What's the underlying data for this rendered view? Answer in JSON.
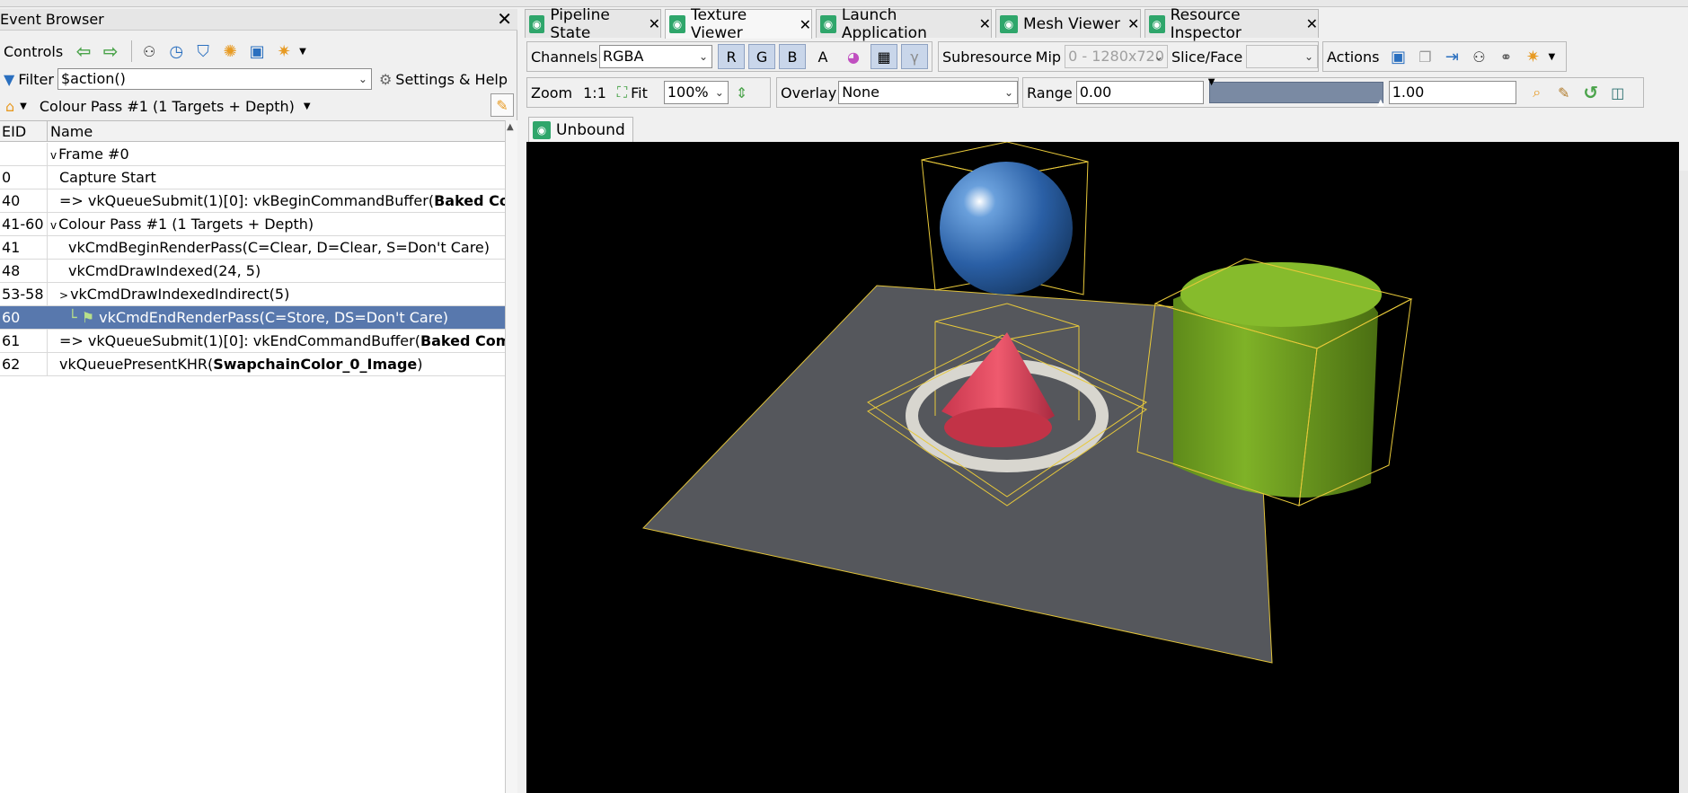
{
  "event_browser": {
    "title": "Event Browser",
    "controls_label": "Controls",
    "filter_label": "Filter",
    "filter_value": "$action()",
    "settings_label": "Settings & Help",
    "breadcrumb": "Colour Pass #1 (1 Targets + Depth)",
    "columns": {
      "eid": "EID",
      "name": "Name"
    },
    "rows": [
      {
        "eid": "",
        "name": "Frame #0",
        "expander": "v",
        "indent": 0
      },
      {
        "eid": "0",
        "name": "Capture Start",
        "expander": "",
        "indent": 1
      },
      {
        "eid": "40",
        "name": "=> vkQueueSubmit(1)[0]: vkBeginCommandBuffer(",
        "bold": "Baked Comm",
        "expander": "",
        "indent": 1
      },
      {
        "eid": "41-60",
        "name": "Colour Pass #1 (1 Targets + Depth)",
        "expander": "v",
        "indent": 0
      },
      {
        "eid": "41",
        "name": "vkCmdBeginRenderPass(C=Clear, D=Clear, S=Don't Care)",
        "expander": "",
        "indent": 2
      },
      {
        "eid": "48",
        "name": "vkCmdDrawIndexed(24, 5)",
        "expander": "",
        "indent": 2
      },
      {
        "eid": "53-58",
        "name": "vkCmdDrawIndexedIndirect(5)",
        "expander": ">",
        "indent": 1
      },
      {
        "eid": "60",
        "name": "vkCmdEndRenderPass(C=Store, DS=Don't Care)",
        "expander": "",
        "indent": 2,
        "selected": true
      },
      {
        "eid": "61",
        "name": "=> vkQueueSubmit(1)[0]: vkEndCommandBuffer(",
        "bold": "Baked Comman",
        "expander": "",
        "indent": 1
      },
      {
        "eid": "62",
        "name": "vkQueuePresentKHR(",
        "bold": "SwapchainColor_0_Image",
        "tail": ")",
        "expander": "",
        "indent": 1
      }
    ]
  },
  "tabs": [
    {
      "label": "Pipeline State"
    },
    {
      "label": "Texture Viewer"
    },
    {
      "label": "Launch Application"
    },
    {
      "label": "Mesh Viewer"
    },
    {
      "label": "Resource Inspector"
    }
  ],
  "texture_viewer": {
    "channels_label": "Channels",
    "channels_value": "RGBA",
    "channel_buttons": [
      "R",
      "G",
      "B",
      "A"
    ],
    "subresource_label": "Subresource",
    "mip_label": "Mip",
    "mip_value": "0 - 1280x720",
    "slice_label": "Slice/Face",
    "actions_label": "Actions",
    "zoom_label": "Zoom",
    "zoom_1to1": "1:1",
    "fit_label": "Fit",
    "zoom_value": "100%",
    "overlay_label": "Overlay",
    "overlay_value": "None",
    "range_label": "Range",
    "range_min": "0.00",
    "range_max": "1.00",
    "unbound_tab": "Unbound"
  }
}
